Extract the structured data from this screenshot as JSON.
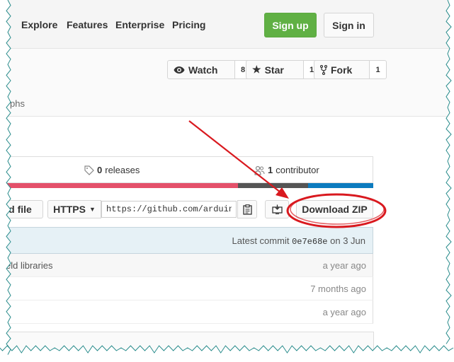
{
  "nav": {
    "links": [
      "Explore",
      "Features",
      "Enterprise",
      "Pricing"
    ],
    "signup": "Sign up",
    "signin": "Sign in"
  },
  "repo": {
    "watch": {
      "label": "Watch",
      "count": "8"
    },
    "star": {
      "label": "Star",
      "count": "1"
    },
    "fork": {
      "label": "Fork",
      "count": "1"
    },
    "partial_tab": "phs"
  },
  "summary": {
    "releases_count": "0",
    "releases_label": "releases",
    "contributors_count": "1",
    "contributors_label": "contributor",
    "lang_colors": [
      "#e4506a",
      "#555555",
      "#0c7bbf"
    ]
  },
  "clone": {
    "partial_button": "d file",
    "protocol": "HTTPS",
    "url": "https://github.com/arduinov",
    "download": "Download ZIP"
  },
  "commit": {
    "prefix": "Latest commit",
    "sha": "0e7e68e",
    "suffix": "on 3 Jun"
  },
  "files": [
    {
      "name": "eld libraries",
      "age": "a year ago"
    },
    {
      "name": "",
      "age": "7 months ago"
    },
    {
      "name": "",
      "age": "a year ago"
    }
  ],
  "colors": {
    "signup_green": "#60b044",
    "annotation_red": "#d9191f"
  }
}
